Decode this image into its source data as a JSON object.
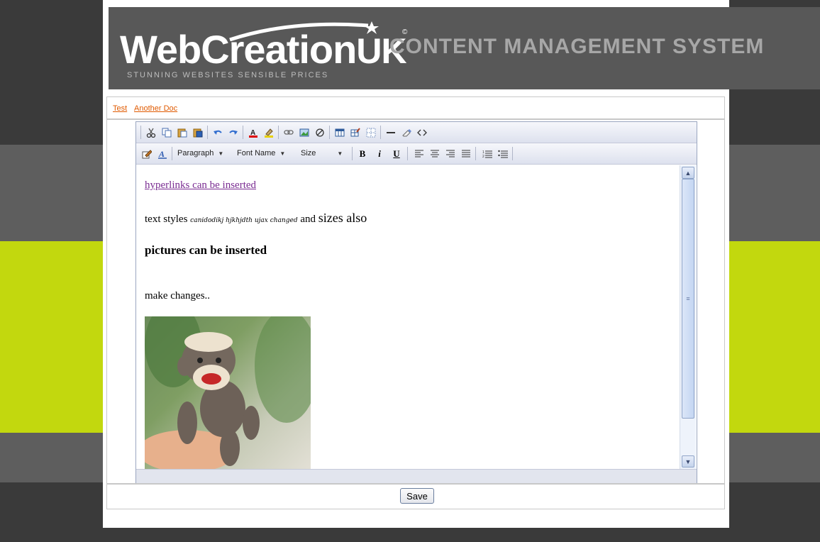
{
  "header": {
    "logo_main": "WebCreation",
    "logo_uk": "UK",
    "logo_copyright": "©",
    "logo_tagline": "STUNNING WEBSITES SENSIBLE PRICES",
    "cms_title": "CONTENT MANAGEMENT SYSTEM"
  },
  "docs": {
    "items": [
      {
        "label": "Test"
      },
      {
        "label": "Another Doc"
      }
    ]
  },
  "toolbar": {
    "row1_icons": [
      "cut-icon",
      "copy-icon",
      "paste-icon",
      "paste-word-icon",
      "undo-icon",
      "redo-icon",
      "font-color-icon",
      "highlight-icon",
      "link-icon",
      "image-icon",
      "unlink-icon",
      "table-icon",
      "table-props-icon",
      "cell-props-icon",
      "horizontal-rule-icon",
      "eraser-icon",
      "source-code-icon"
    ],
    "row2_icons": [
      "edit-icon",
      "style-icon"
    ],
    "format_select": "Paragraph",
    "font_select": "Font Name",
    "size_select": "Size",
    "bold_label": "B",
    "italic_label": "i",
    "underline_label": "U"
  },
  "content": {
    "link_text": "hyperlinks can be inserted",
    "styles_prefix": "text styles ",
    "styles_script": "canidodikj hjkhjdth ujax changed",
    "styles_and": " and ",
    "styles_big": "sizes also",
    "pictures_text": "pictures can be inserted",
    "make_changes": "make changes..",
    "photo_icon": "sock-monkey-photo"
  },
  "save_label": "Save",
  "colors": {
    "lime": "#c2d80e",
    "header_bg": "#585858",
    "link": "#7a2c92",
    "doc_link": "#e05a00"
  }
}
